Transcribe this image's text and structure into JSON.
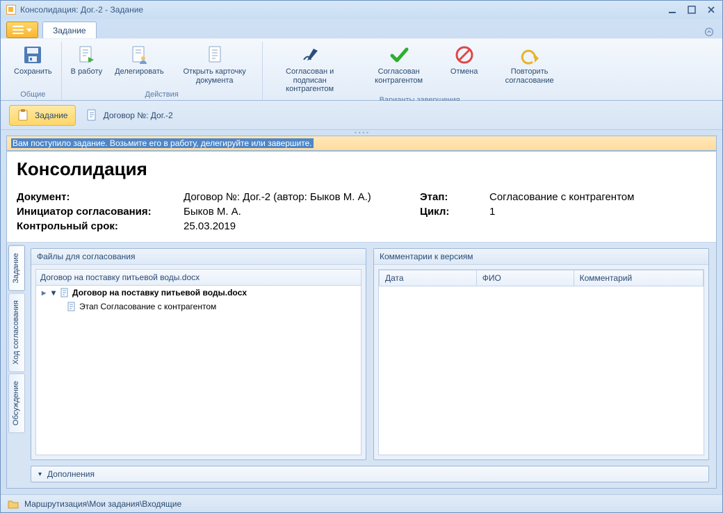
{
  "window": {
    "title": "Консолидация: Дог.-2 - Задание"
  },
  "ribbon": {
    "tab": "Задание",
    "groups": {
      "common": {
        "label": "Общие",
        "save": "Сохранить"
      },
      "actions": {
        "label": "Действия",
        "toWork": "В работу",
        "delegate": "Делегировать",
        "openCard": "Открыть карточку документа"
      },
      "completion": {
        "label": "Варианты завершения",
        "signed": "Согласован и подписан контрагентом",
        "agreed": "Согласован контрагентом",
        "cancel": "Отмена",
        "repeat": "Повторить согласование"
      }
    }
  },
  "chips": {
    "task": "Задание",
    "doc": "Договор №: Дог.-2"
  },
  "banner": "Вам поступило задание. Возьмите его в работу, делегируйте или завершите.",
  "doc": {
    "title": "Консолидация",
    "fields": {
      "documentLabel": "Документ:",
      "documentValue": "Договор №: Дог.-2 (автор: Быков М. А.)",
      "stageLabel": "Этап:",
      "stageValue": "Согласование с контрагентом",
      "initiatorLabel": "Инициатор согласования:",
      "initiatorValue": "Быков М. А.",
      "cycleLabel": "Цикл:",
      "cycleValue": "1",
      "deadlineLabel": "Контрольный срок:",
      "deadlineValue": "25.03.2019"
    }
  },
  "vtabs": {
    "task": "Задание",
    "flow": "Ход согласования",
    "discussion": "Обсуждение"
  },
  "panels": {
    "files": {
      "title": "Файлы для согласования",
      "header": "Договор на поставку питьевой воды.docx",
      "node": "Договор на поставку питьевой воды.docx",
      "child": "Этап Согласование с контрагентом"
    },
    "comments": {
      "title": "Комментарии к версиям",
      "cols": {
        "date": "Дата",
        "fio": "ФИО",
        "comment": "Комментарий"
      }
    },
    "extras": "Дополнения"
  },
  "status": {
    "path": "Маршрутизация\\Мои задания\\Входящие"
  }
}
